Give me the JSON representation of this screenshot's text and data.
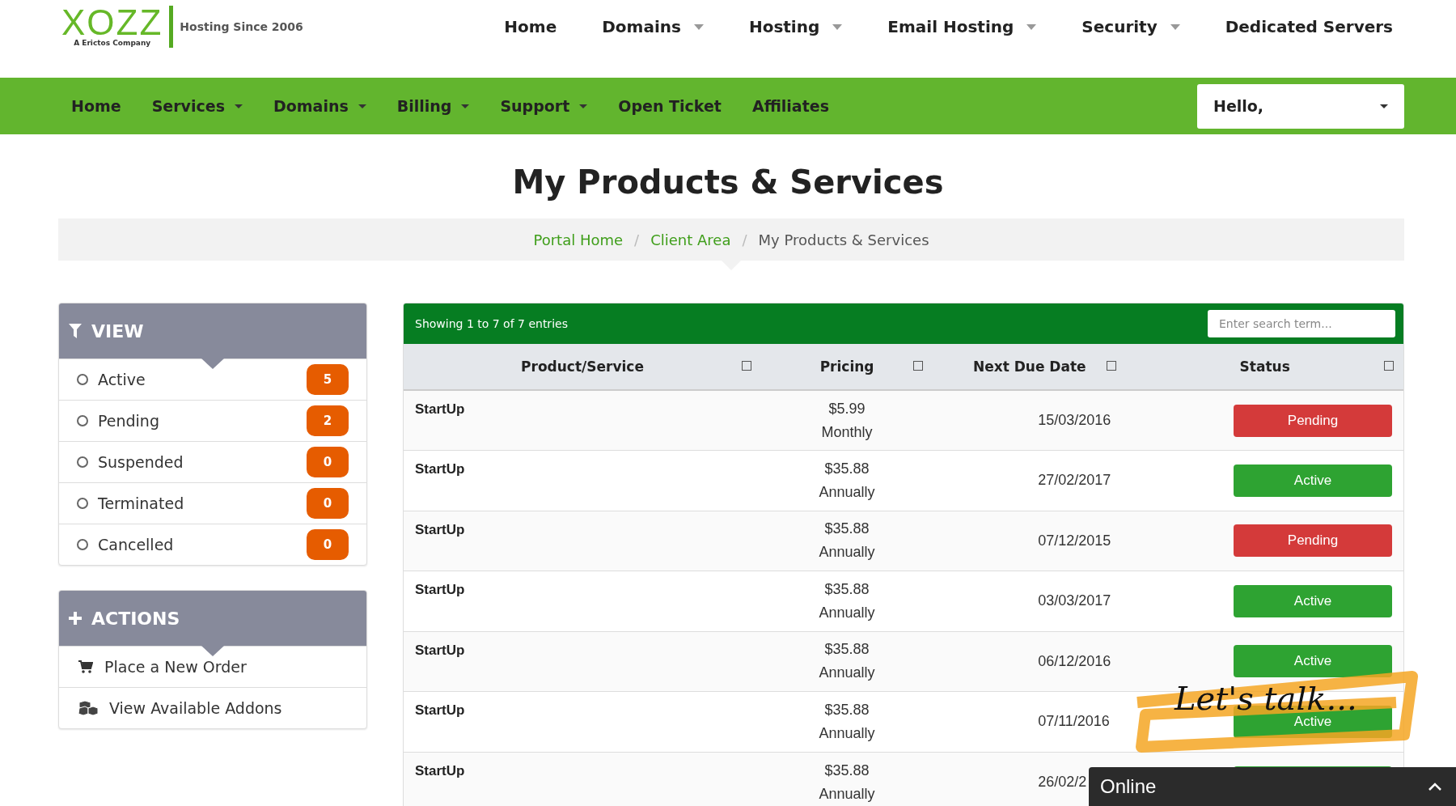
{
  "logo": {
    "name": "XOZZ",
    "tagline": "A Erictos Company",
    "slogan": "Hosting Since 2006"
  },
  "top_nav": [
    {
      "label": "Home",
      "dropdown": false
    },
    {
      "label": "Domains",
      "dropdown": true
    },
    {
      "label": "Hosting",
      "dropdown": true
    },
    {
      "label": "Email Hosting",
      "dropdown": true
    },
    {
      "label": "Security",
      "dropdown": true
    },
    {
      "label": "Dedicated Servers",
      "dropdown": false
    }
  ],
  "main_nav": [
    {
      "label": "Home",
      "dropdown": false
    },
    {
      "label": "Services",
      "dropdown": true
    },
    {
      "label": "Domains",
      "dropdown": true
    },
    {
      "label": "Billing",
      "dropdown": true
    },
    {
      "label": "Support",
      "dropdown": true
    },
    {
      "label": "Open Ticket",
      "dropdown": false
    },
    {
      "label": "Affiliates",
      "dropdown": false
    }
  ],
  "account_menu": {
    "label": "Hello,"
  },
  "page_title": "My Products & Services",
  "breadcrumb": [
    {
      "label": "Portal Home",
      "link": true
    },
    {
      "separator": "/",
      "label": "Client Area",
      "link": true
    },
    {
      "separator": "/",
      "label": "My Products & Services",
      "link": false
    }
  ],
  "view_panel": {
    "title": "VIEW",
    "items": [
      {
        "label": "Active",
        "count": "5",
        "selected": false
      },
      {
        "label": "Pending",
        "count": "2",
        "selected": false
      },
      {
        "label": "Suspended",
        "count": "0",
        "selected": false
      },
      {
        "label": "Terminated",
        "count": "0",
        "selected": false
      },
      {
        "label": "Cancelled",
        "count": "0",
        "selected": false
      }
    ]
  },
  "actions_panel": {
    "title": "ACTIONS",
    "items": [
      {
        "label": "Place a New Order",
        "kind": "cart"
      },
      {
        "label": "View Available Addons",
        "kind": "cubes"
      }
    ]
  },
  "table": {
    "info": "Showing 1 to 7 of 7 entries",
    "search": {
      "placeholder": "Enter search term..."
    },
    "columns": [
      "Product/Service",
      "Pricing",
      "Next Due Date",
      "Status"
    ],
    "rows": [
      {
        "product": "StartUp",
        "price": "$5.99",
        "cycle": "Monthly",
        "due": "15/03/2016",
        "status": "Pending",
        "kind": "pending"
      },
      {
        "product": "StartUp",
        "price": "$35.88",
        "cycle": "Annually",
        "due": "27/02/2017",
        "status": "Active",
        "kind": "active"
      },
      {
        "product": "StartUp",
        "price": "$35.88",
        "cycle": "Annually",
        "due": "07/12/2015",
        "status": "Pending",
        "kind": "pending"
      },
      {
        "product": "StartUp",
        "price": "$35.88",
        "cycle": "Annually",
        "due": "03/03/2017",
        "status": "Active",
        "kind": "active"
      },
      {
        "product": "StartUp",
        "price": "$35.88",
        "cycle": "Annually",
        "due": "06/12/2016",
        "status": "Active",
        "kind": "active"
      },
      {
        "product": "StartUp",
        "price": "$35.88",
        "cycle": "Annually",
        "due": "07/11/2016",
        "status": "Active",
        "kind": "active"
      },
      {
        "product": "StartUp",
        "price": "$35.88",
        "cycle": "Annually",
        "due": "26/02/2",
        "kind": "active"
      }
    ]
  },
  "chat_promo": "Let's talk...",
  "chat_widget": {
    "label": "Online"
  }
}
